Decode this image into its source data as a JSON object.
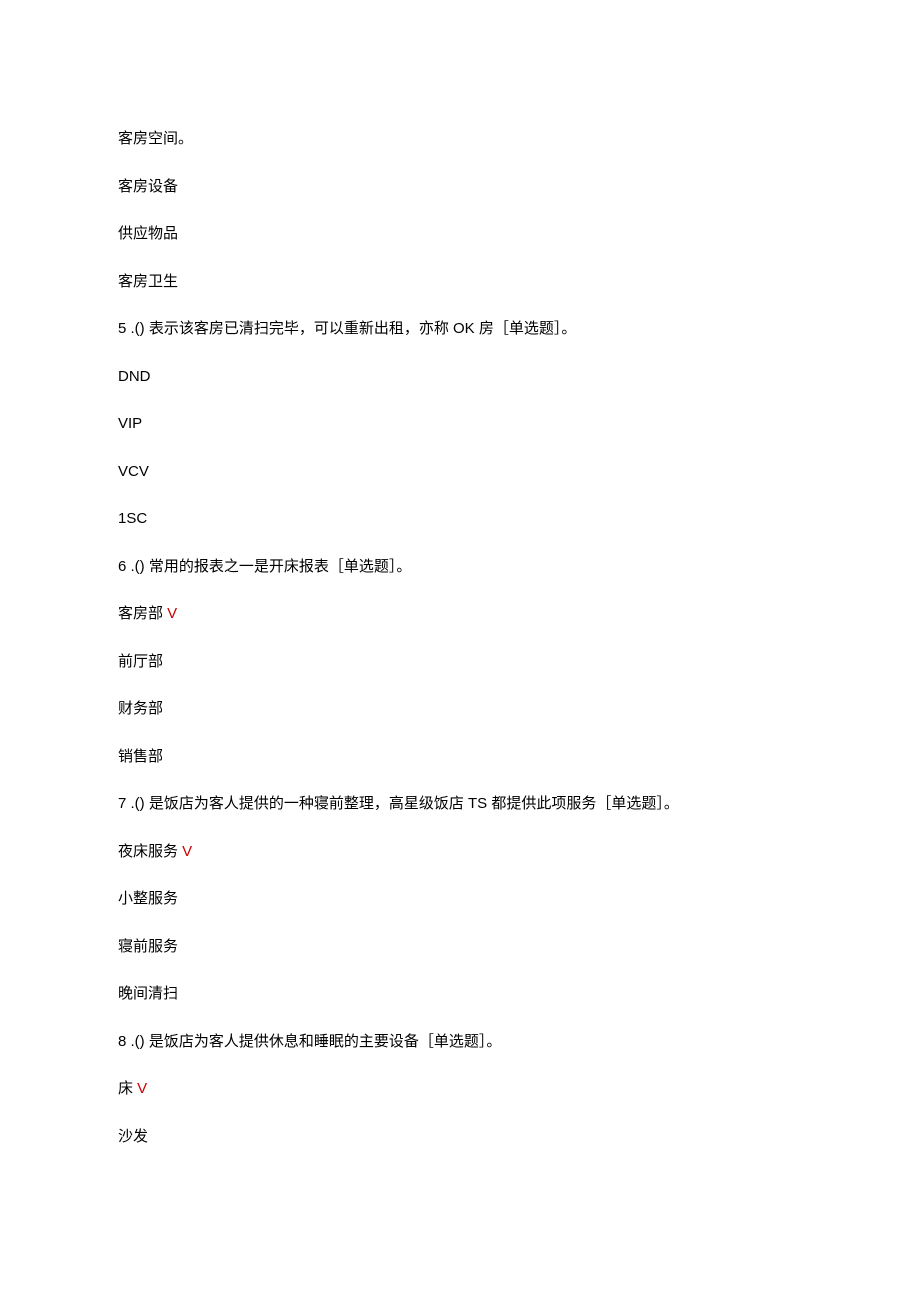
{
  "q4_options": {
    "a": "客房空间。",
    "b": "客房设备",
    "c": "供应物品",
    "d": "客房卫生"
  },
  "q5": {
    "num": "5",
    "text": " .() 表示该客房已清扫完毕，可以重新出租，亦称 OK 房［单选题］。",
    "options": {
      "a": "DND",
      "b": "VIP",
      "c": "VCV",
      "d": "1SC"
    }
  },
  "q6": {
    "num": "6",
    "text": " .() 常用的报表之一是开床报表［单选题］。",
    "options": {
      "a": "客房部 ",
      "a_mark": "V",
      "b": "前厅部",
      "c": "财务部",
      "d": "销售部"
    }
  },
  "q7": {
    "num": "7",
    "text": " .() 是饭店为客人提供的一种寝前整理，高星级饭店 TS 都提供此项服务［单选题］。",
    "options": {
      "a": "夜床服务 ",
      "a_mark": "V",
      "b": "小整服务",
      "c": "寝前服务",
      "d": "晚间清扫"
    }
  },
  "q8": {
    "num": "8",
    "text": " .() 是饭店为客人提供休息和睡眠的主要设备［单选题］。",
    "options": {
      "a": "床 ",
      "a_mark": "V",
      "b": "沙发"
    }
  }
}
